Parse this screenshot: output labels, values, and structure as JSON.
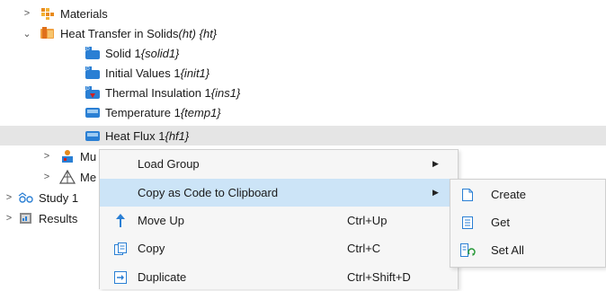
{
  "tree": [
    {
      "label": "Materials",
      "tag": "",
      "icon": "materials-icon",
      "chevron": ">"
    },
    {
      "label": "Heat Transfer in Solids ",
      "tag": "(ht) {ht}",
      "icon": "heat-transfer-icon",
      "chevron": "v"
    },
    {
      "label": "Solid 1 ",
      "tag": "{solid1}",
      "icon": "solid-icon",
      "chevron": ""
    },
    {
      "label": "Initial Values 1 ",
      "tag": "{init1}",
      "icon": "initial-values-icon",
      "chevron": ""
    },
    {
      "label": "Thermal Insulation 1 ",
      "tag": "{ins1}",
      "icon": "thermal-insulation-icon",
      "chevron": ""
    },
    {
      "label": "Temperature 1 ",
      "tag": "{temp1}",
      "icon": "temperature-icon",
      "chevron": ""
    },
    {
      "label": "Heat Flux 1 ",
      "tag": "{hf1}",
      "icon": "heat-flux-icon",
      "chevron": ""
    },
    {
      "label": "Mu",
      "tag": "",
      "icon": "multiphysics-icon",
      "chevron": ">"
    },
    {
      "label": "Me",
      "tag": "",
      "icon": "mesh-icon",
      "chevron": ">"
    },
    {
      "label": "Study 1",
      "tag": "",
      "icon": "study-icon",
      "chevron": ">"
    },
    {
      "label": "Results",
      "tag": "",
      "icon": "results-icon",
      "chevron": ">"
    }
  ],
  "context_menu": [
    {
      "label": "Load Group",
      "shortcut": "",
      "arrow": "▶",
      "icon": ""
    },
    {
      "label": "Copy as Code to Clipboard",
      "shortcut": "",
      "arrow": "▶",
      "icon": ""
    },
    {
      "label": "Move Up",
      "shortcut": "Ctrl+Up",
      "arrow": "",
      "icon": "move-up-icon"
    },
    {
      "label": "Copy",
      "shortcut": "Ctrl+C",
      "arrow": "",
      "icon": "copy-icon"
    },
    {
      "label": "Duplicate",
      "shortcut": "Ctrl+Shift+D",
      "arrow": "",
      "icon": "duplicate-icon"
    }
  ],
  "submenu": [
    {
      "label": "Create",
      "icon": "create-icon"
    },
    {
      "label": "Get",
      "icon": "get-icon"
    },
    {
      "label": "Set All",
      "icon": "set-all-icon"
    }
  ],
  "colors": {
    "highlight_row": "#e5e5e5",
    "menu_active": "#cce4f7",
    "menu_bg": "#f6f6f6",
    "icon_blue": "#2a7fd4",
    "icon_orange": "#e88a1a"
  }
}
